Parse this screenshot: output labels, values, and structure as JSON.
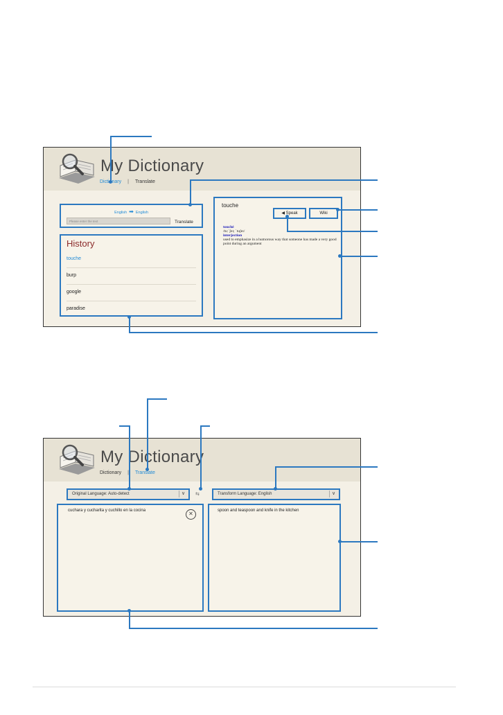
{
  "screen1": {
    "app_title": "My Dictionary",
    "nav": {
      "dictionary": "Dictionary",
      "separator": "|",
      "translate": "Translate"
    },
    "lookup": {
      "source_lang": "English",
      "target_lang": "English",
      "arrow_icon": "right-arrow-icon",
      "placeholder": "Please enter the text",
      "translate_label": "Translate"
    },
    "history": {
      "title": "History",
      "items": [
        "touche",
        "burp",
        "google",
        "paradise"
      ]
    },
    "definition": {
      "word": "touche",
      "speak_label": "Speak",
      "wiki_label": "Wiki",
      "headword": "touché",
      "pronunciation": "/tuːˈʃeɪ; ˈtuʃeɪ/",
      "part_of_speech": "interjection",
      "meaning": "used to emphasize in a humorous way that someone has made a very good point during an argument"
    }
  },
  "screen2": {
    "app_title": "My Dictionary",
    "nav": {
      "dictionary": "Dictionary",
      "separator": "|",
      "translate": "Translate"
    },
    "original_language": "Original Language: Auto-detect",
    "transform_language": "Transform Language: English",
    "source_text": "cuchara y cucharita y cuchillo en la cocina",
    "translated_text": "spoon and teaspoon and knife in the kitchen",
    "swap_glyph": "⇆",
    "clear_glyph": "✕"
  },
  "colors": {
    "accent": "#2b78c0",
    "link": "#1f8ad6",
    "history_title": "#8b2a2a",
    "background": "#f4f0e6"
  }
}
